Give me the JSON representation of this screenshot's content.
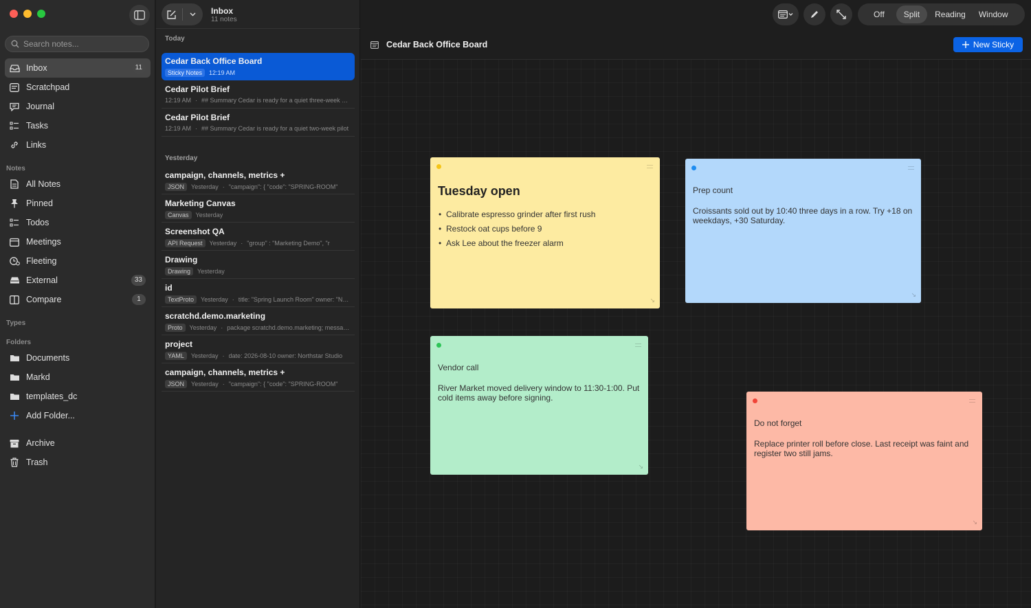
{
  "sidebar": {
    "search_placeholder": "Search notes...",
    "main_items": [
      {
        "label": "Inbox",
        "badge": "11"
      },
      {
        "label": "Scratchpad"
      },
      {
        "label": "Journal"
      },
      {
        "label": "Tasks"
      },
      {
        "label": "Links"
      }
    ],
    "notes_section": "Notes",
    "notes_items": [
      {
        "label": "All Notes"
      },
      {
        "label": "Pinned"
      },
      {
        "label": "Todos"
      },
      {
        "label": "Meetings"
      },
      {
        "label": "Fleeting"
      },
      {
        "label": "External",
        "badge": "33"
      },
      {
        "label": "Compare",
        "badge": "1"
      }
    ],
    "types_section": "Types",
    "folders_section": "Folders",
    "folders": [
      {
        "label": "Documents"
      },
      {
        "label": "Markd"
      },
      {
        "label": "templates_dc"
      }
    ],
    "add_folder": "Add Folder...",
    "bottom_items": [
      {
        "label": "Archive"
      },
      {
        "label": "Trash"
      }
    ]
  },
  "list": {
    "title": "Inbox",
    "count": "11 notes",
    "today_label": "Today",
    "yesterday_label": "Yesterday",
    "today": [
      {
        "title": "Cedar Back Office Board",
        "tag": "Sticky Notes",
        "time": "12:19 AM",
        "preview": ""
      },
      {
        "title": "Cedar Pilot Brief",
        "tag": "",
        "time": "12:19 AM",
        "preview": "## Summary Cedar is ready for a quiet three-week pilot"
      },
      {
        "title": "Cedar Pilot Brief",
        "tag": "",
        "time": "12:19 AM",
        "preview": "## Summary Cedar is ready for a quiet two-week pilot"
      }
    ],
    "yesterday": [
      {
        "title": "campaign, channels, metrics +",
        "tag": "JSON",
        "time": "Yesterday",
        "preview": "\"campaign\": {    \"code\": \"SPRING-ROOM\""
      },
      {
        "title": "Marketing Canvas",
        "tag": "Canvas",
        "time": "Yesterday",
        "preview": ""
      },
      {
        "title": "Screenshot QA",
        "tag": "API Request",
        "time": "Yesterday",
        "preview": "\"group\" : \"Marketing Demo\",   \"r"
      },
      {
        "title": "Drawing",
        "tag": "Drawing",
        "time": "Yesterday",
        "preview": ""
      },
      {
        "title": "id",
        "tag": "TextProto",
        "time": "Yesterday",
        "preview": "title: \"Spring Launch Room\" owner: \"Northstar\""
      },
      {
        "title": "scratchd.demo.marketing",
        "tag": "Proto",
        "time": "Yesterday",
        "preview": "package scratchd.demo.marketing; message Launch"
      },
      {
        "title": "project",
        "tag": "YAML",
        "time": "Yesterday",
        "preview": "date: 2026-08-10 owner: Northstar Studio"
      },
      {
        "title": "campaign, channels, metrics +",
        "tag": "JSON",
        "time": "Yesterday",
        "preview": "\"campaign\": {    \"code\": \"SPRING-ROOM\""
      }
    ]
  },
  "toolbar": {
    "modes": [
      "Off",
      "Split",
      "Reading",
      "Window"
    ],
    "active_mode": "Split"
  },
  "document": {
    "title": "Cedar Back Office Board",
    "new_sticky": "New Sticky"
  },
  "stickies": {
    "tuesday": {
      "title": "Tuesday open",
      "items": [
        "Calibrate espresso grinder after first rush",
        "Restock oat cups before 9",
        "Ask Lee about the freezer alarm"
      ],
      "color": "#fdeba1",
      "dot": "#f5c518"
    },
    "prep": {
      "heading": "Prep count",
      "body": "Croissants sold out by 10:40 three days in a row. Try +18 on weekdays, +30 Saturday.",
      "color": "#b3d8fb",
      "dot": "#1e8cf0"
    },
    "vendor": {
      "heading": "Vendor call",
      "body": "River Market moved delivery window to 11:30-1:00. Put cold items away before signing.",
      "color": "#b3edca",
      "dot": "#2ec458"
    },
    "forget": {
      "heading": "Do not forget",
      "body": "Replace printer roll before close. Last receipt was faint and register two still jams.",
      "color": "#fdb9a6",
      "dot": "#f04438"
    }
  },
  "colors": {
    "accent": "#0b63e5",
    "traffic_close": "#fe5f57",
    "traffic_min": "#febc2e",
    "traffic_max": "#28c840"
  }
}
